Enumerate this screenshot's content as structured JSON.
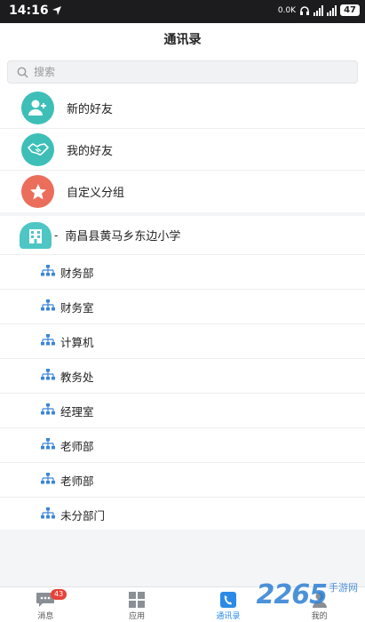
{
  "statusbar": {
    "time": "14:16",
    "net_speed": "0.0K",
    "battery": "47"
  },
  "header": {
    "title": "通讯录"
  },
  "search": {
    "placeholder": "搜索"
  },
  "quick_items": [
    {
      "label": "新的好友",
      "icon": "add-user-icon",
      "color": "#3dbfb8"
    },
    {
      "label": "我的好友",
      "icon": "handshake-icon",
      "color": "#3dbfb8"
    },
    {
      "label": "自定义分组",
      "icon": "star-icon",
      "color": "#ea6e5b"
    }
  ],
  "organization": {
    "name": "南昌县黄马乡东边小学",
    "icon": "building-icon",
    "departments": [
      "财务部",
      "财务室",
      "计算机",
      "教务处",
      "经理室",
      "老师部",
      "老师部",
      "未分部门"
    ]
  },
  "tabbar": {
    "tabs": [
      {
        "label": "消息",
        "icon": "message-icon",
        "badge": "43"
      },
      {
        "label": "应用",
        "icon": "apps-grid-icon"
      },
      {
        "label": "通讯录",
        "icon": "contacts-icon",
        "active": true
      },
      {
        "label": "我的",
        "icon": "profile-icon"
      }
    ]
  },
  "watermark": {
    "number": "2265",
    "site": "手游网"
  },
  "colors": {
    "accent": "#2b8ae8",
    "teal": "#3dbfb8",
    "coral": "#ea6e5b"
  }
}
